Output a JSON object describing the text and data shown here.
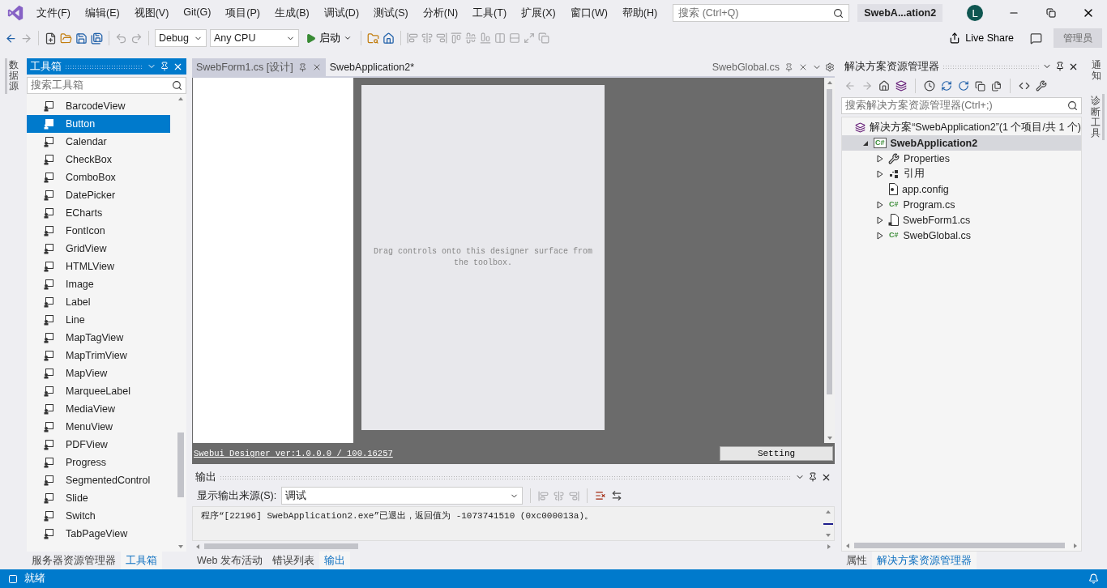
{
  "menu": [
    "文件(F)",
    "编辑(E)",
    "视图(V)",
    "Git(G)",
    "项目(P)",
    "生成(B)",
    "调试(D)",
    "测试(S)",
    "分析(N)",
    "工具(T)",
    "扩展(X)",
    "窗口(W)",
    "帮助(H)"
  ],
  "search": {
    "placeholder": "搜索 (Ctrl+Q)"
  },
  "solution_title": "SwebA...ation2",
  "account": {
    "initial": "L"
  },
  "toolbar": {
    "configuration": "Debug",
    "platform": "Any CPU",
    "start": "启动",
    "live_share": "Live Share",
    "admin": "管理员"
  },
  "left_strip": [
    "数据源"
  ],
  "toolbox": {
    "title": "工具箱",
    "search_placeholder": "搜索工具箱",
    "items": [
      {
        "label": "BarcodeView",
        "selected": false
      },
      {
        "label": "Button",
        "selected": true
      },
      {
        "label": "Calendar",
        "selected": false
      },
      {
        "label": "CheckBox",
        "selected": false
      },
      {
        "label": "ComboBox",
        "selected": false
      },
      {
        "label": "DatePicker",
        "selected": false
      },
      {
        "label": "ECharts",
        "selected": false
      },
      {
        "label": "FontIcon",
        "selected": false
      },
      {
        "label": "GridView",
        "selected": false
      },
      {
        "label": "HTMLView",
        "selected": false
      },
      {
        "label": "Image",
        "selected": false
      },
      {
        "label": "Label",
        "selected": false
      },
      {
        "label": "Line",
        "selected": false
      },
      {
        "label": "MapTagView",
        "selected": false
      },
      {
        "label": "MapTrimView",
        "selected": false
      },
      {
        "label": "MapView",
        "selected": false
      },
      {
        "label": "MarqueeLabel",
        "selected": false
      },
      {
        "label": "MediaView",
        "selected": false
      },
      {
        "label": "MenuView",
        "selected": false
      },
      {
        "label": "PDFView",
        "selected": false
      },
      {
        "label": "Progress",
        "selected": false
      },
      {
        "label": "SegmentedControl",
        "selected": false
      },
      {
        "label": "Slide",
        "selected": false
      },
      {
        "label": "Switch",
        "selected": false
      },
      {
        "label": "TabPageView",
        "selected": false
      }
    ],
    "tabs": [
      {
        "label": "服务器资源管理器",
        "selected": false
      },
      {
        "label": "工具箱",
        "selected": true
      }
    ]
  },
  "editor": {
    "tabs": [
      {
        "label": "SwebForm1.cs [设计]",
        "selected": true,
        "kind": "document"
      },
      {
        "label": "SwebApplication2*",
        "selected": false,
        "kind": "document"
      },
      {
        "label": "SwebGlobal.cs",
        "selected": false,
        "kind": "preview"
      }
    ]
  },
  "designer": {
    "hint": "Drag controls onto this designer surface from the toolbox.",
    "version_link": "Swebui Designer ver:1.0.0.0 / 100.16257",
    "setting": "Setting"
  },
  "output": {
    "title": "输出",
    "source_label": "显示输出来源(S):",
    "source_value": "调试",
    "lines": [
      "程序“[22196] SwebApplication2.exe”已退出，返回值为 -1073741510 (0xc000013a)。"
    ]
  },
  "bottom_tabs": [
    {
      "label": "Web 发布活动",
      "selected": false
    },
    {
      "label": "错误列表",
      "selected": false
    },
    {
      "label": "输出",
      "selected": true
    }
  ],
  "solution_explorer": {
    "title": "解决方案资源管理器",
    "search_placeholder": "搜索解决方案资源管理器(Ctrl+;)",
    "tree": [
      {
        "label": "解决方案“SwebApplication2”(1 个项目/共 1 个)",
        "kind": "solution",
        "selected": false,
        "children": [
          {
            "label": "SwebApplication2",
            "kind": "project",
            "icon_label": "C#",
            "expanded": true,
            "selected": true,
            "children": [
              {
                "label": "Properties",
                "kind": "properties",
                "expanded": false,
                "selected": false
              },
              {
                "label": "引用",
                "kind": "references",
                "expanded": false,
                "selected": false
              },
              {
                "label": "app.config",
                "kind": "config",
                "selected": false
              },
              {
                "label": "Program.cs",
                "kind": "csharp",
                "icon_label": "C#",
                "expanded": false,
                "selected": false
              },
              {
                "label": "SwebForm1.cs",
                "kind": "form",
                "expanded": false,
                "selected": false
              },
              {
                "label": "SwebGlobal.cs",
                "kind": "csharp",
                "icon_label": "C#",
                "expanded": false,
                "selected": false
              }
            ]
          }
        ]
      }
    ],
    "tabs": [
      {
        "label": "属性",
        "selected": false
      },
      {
        "label": "解决方案资源管理器",
        "selected": true
      }
    ]
  },
  "right_strip": [
    "通知",
    "诊断工具"
  ],
  "status": "就绪"
}
